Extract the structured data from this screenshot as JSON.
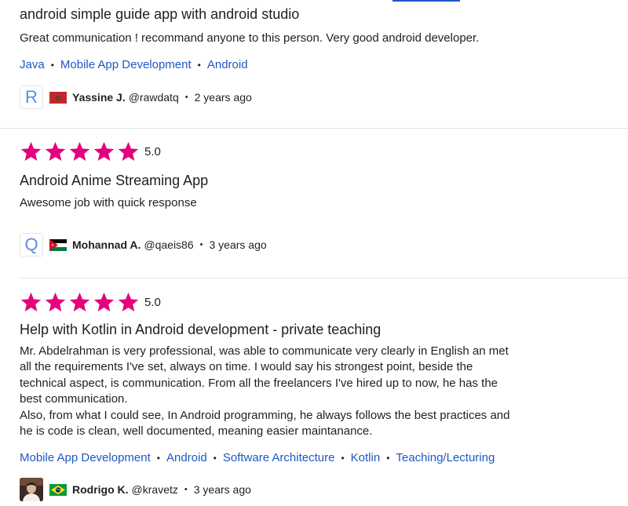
{
  "colors": {
    "star": "#e5007d",
    "link": "#1f57c3",
    "divider": "#e4e5e7"
  },
  "reviews": [
    {
      "title": "android simple guide app with android studio",
      "body": "Great communication ! recommand anyone to this person. Very good android developer.",
      "skills": [
        "Java",
        "Mobile App Development",
        "Android"
      ],
      "reviewer": {
        "avatar_letter": "R",
        "flag": "morocco-flag",
        "name": "Yassine J.",
        "handle": "@rawdatq",
        "date": "2 years ago"
      }
    },
    {
      "rating": "5.0",
      "stars": 5,
      "title": "Android Anime Streaming App",
      "body": "Awesome job with quick response",
      "skills": [],
      "reviewer": {
        "avatar_letter": "Q",
        "flag": "jordan-flag",
        "name": "Mohannad A.",
        "handle": "@qaeis86",
        "date": "3 years ago"
      }
    },
    {
      "rating": "5.0",
      "stars": 5,
      "title": "Help with Kotlin in Android development - private teaching",
      "body": "Mr. Abdelrahman is very professional, was able to communicate very clearly in English an met all the requirements I've set, always on time. I would say his strongest point, beside the technical aspect, is communication. From all the freelancers I've hired up to now, he has the best communication.\nAlso, from what I could see, In Android programming, he always follows the best practices and he is code is clean, well documented, meaning easier maintanance.",
      "skills": [
        "Mobile App Development",
        "Android",
        "Software Architecture",
        "Kotlin",
        "Teaching/Lecturing"
      ],
      "reviewer": {
        "avatar": "reviewer-photo",
        "flag": "brazil-flag",
        "name": "Rodrigo K.",
        "handle": "@kravetz",
        "date": "3 years ago"
      }
    }
  ]
}
